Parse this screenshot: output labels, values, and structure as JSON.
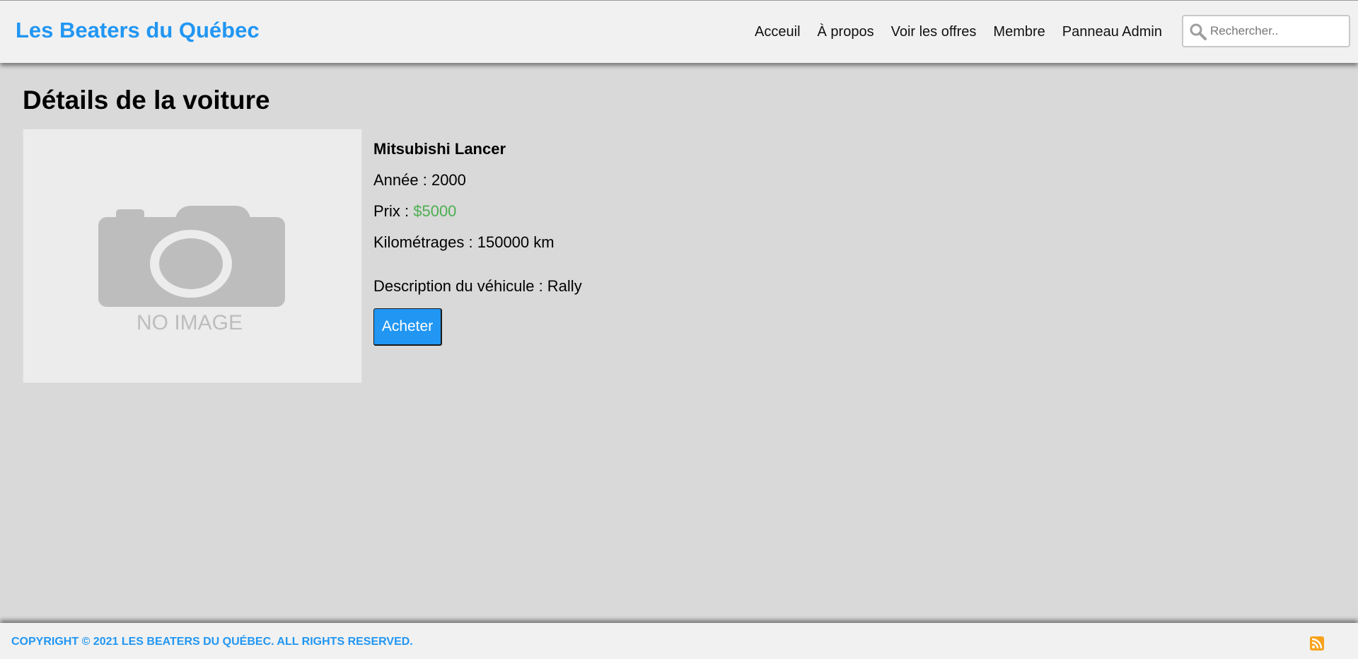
{
  "header": {
    "logo": "Les Beaters du Québec",
    "nav": [
      "Acceuil",
      "À propos",
      "Voir les offres",
      "Membre",
      "Panneau Admin"
    ],
    "search": {
      "placeholder": "Rechercher..",
      "value": ""
    }
  },
  "main": {
    "title": "Détails de la voiture",
    "image_text": "NO IMAGE",
    "car": {
      "name": "Mitsubishi Lancer",
      "year_label": "Année : ",
      "year": "2000",
      "price_label": "Prix : ",
      "price": "$5000",
      "mileage_label": "Kilométrages : ",
      "mileage": "150000 km",
      "description_label": "Description du véhicule : ",
      "description": "Rally"
    },
    "buy_label": "Acheter"
  },
  "footer": {
    "copyright": "COPYRIGHT © 2021 LES BEATERS DU QUÉBEC. ALL RIGHTS RESERVED.",
    "rss_icon": "rss-icon"
  },
  "colors": {
    "accent": "#2196f3",
    "price": "#4caf50",
    "background": "#d9d9d9",
    "rss": "#f7a21b"
  }
}
